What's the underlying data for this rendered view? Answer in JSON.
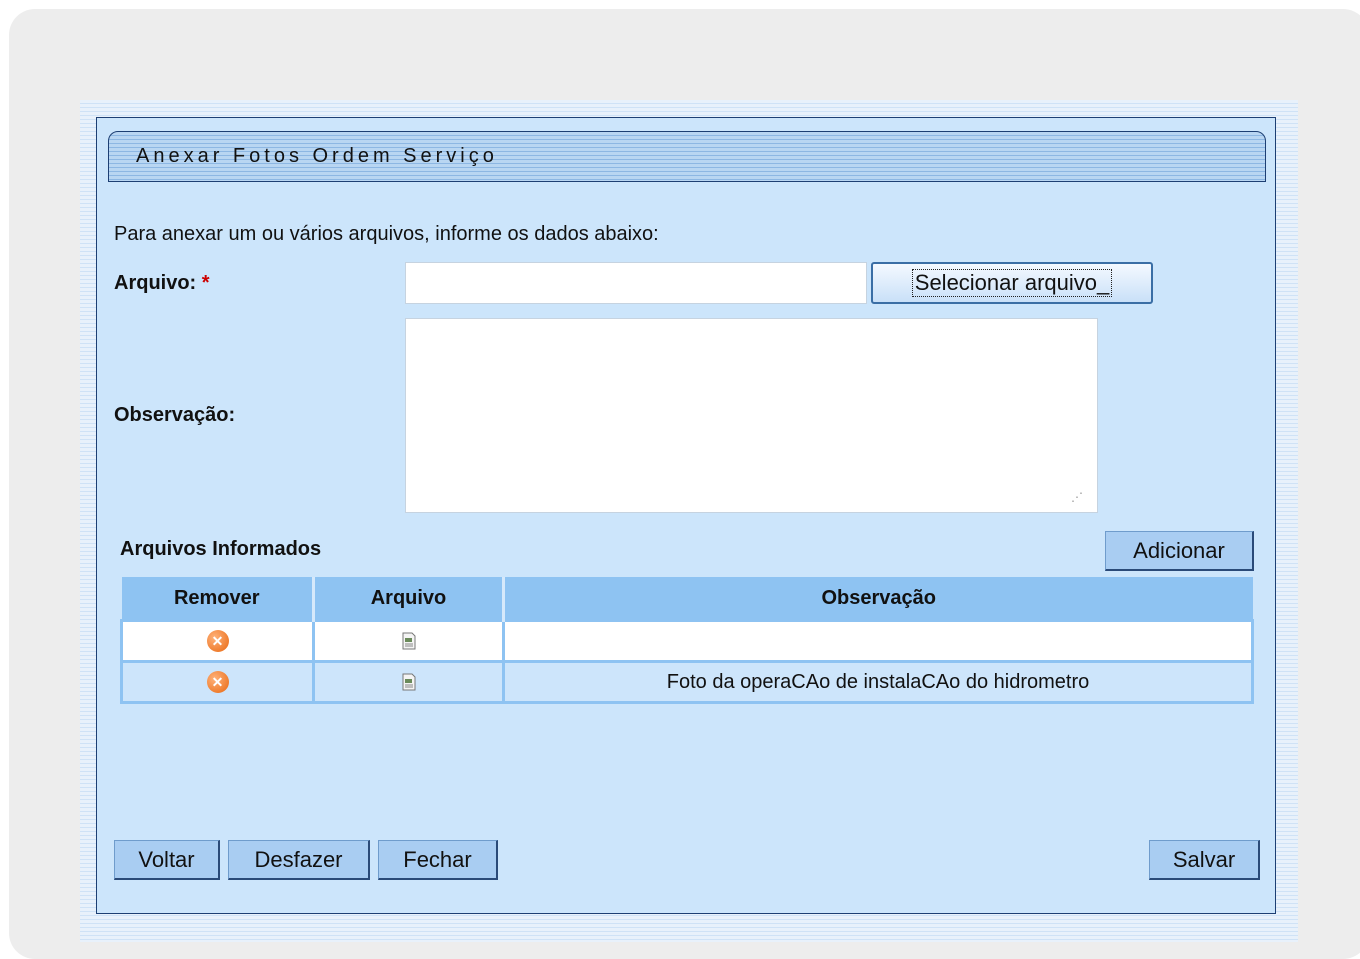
{
  "window": {
    "title": "Anexar Fotos Ordem Serviço"
  },
  "form": {
    "intro": "Para anexar um ou vários arquivos, informe os dados abaixo:",
    "arquivo_label": "Arquivo:",
    "required_mark": "*",
    "arquivo_value": "",
    "select_button": "Selecionar arquivo_",
    "observacao_label": "Observação:",
    "observacao_value": ""
  },
  "files_section": {
    "title": "Arquivos Informados",
    "add_button": "Adicionar",
    "columns": [
      "Remover",
      "Arquivo",
      "Observação"
    ],
    "rows": [
      {
        "remove_icon": "remove-icon",
        "file_icon": "document-icon",
        "observacao": ""
      },
      {
        "remove_icon": "remove-icon",
        "file_icon": "document-icon",
        "observacao": "Foto da operaCAo de instalaCAo do hidrometro"
      }
    ]
  },
  "footer": {
    "voltar": "Voltar",
    "desfazer": "Desfazer",
    "fechar": "Fechar",
    "salvar": "Salvar"
  },
  "colors": {
    "panel_bg": "#cce5fb",
    "header_bg": "#8ec3f2",
    "button_bg": "#a9cdf2",
    "remove_icon": "#e8670f"
  }
}
